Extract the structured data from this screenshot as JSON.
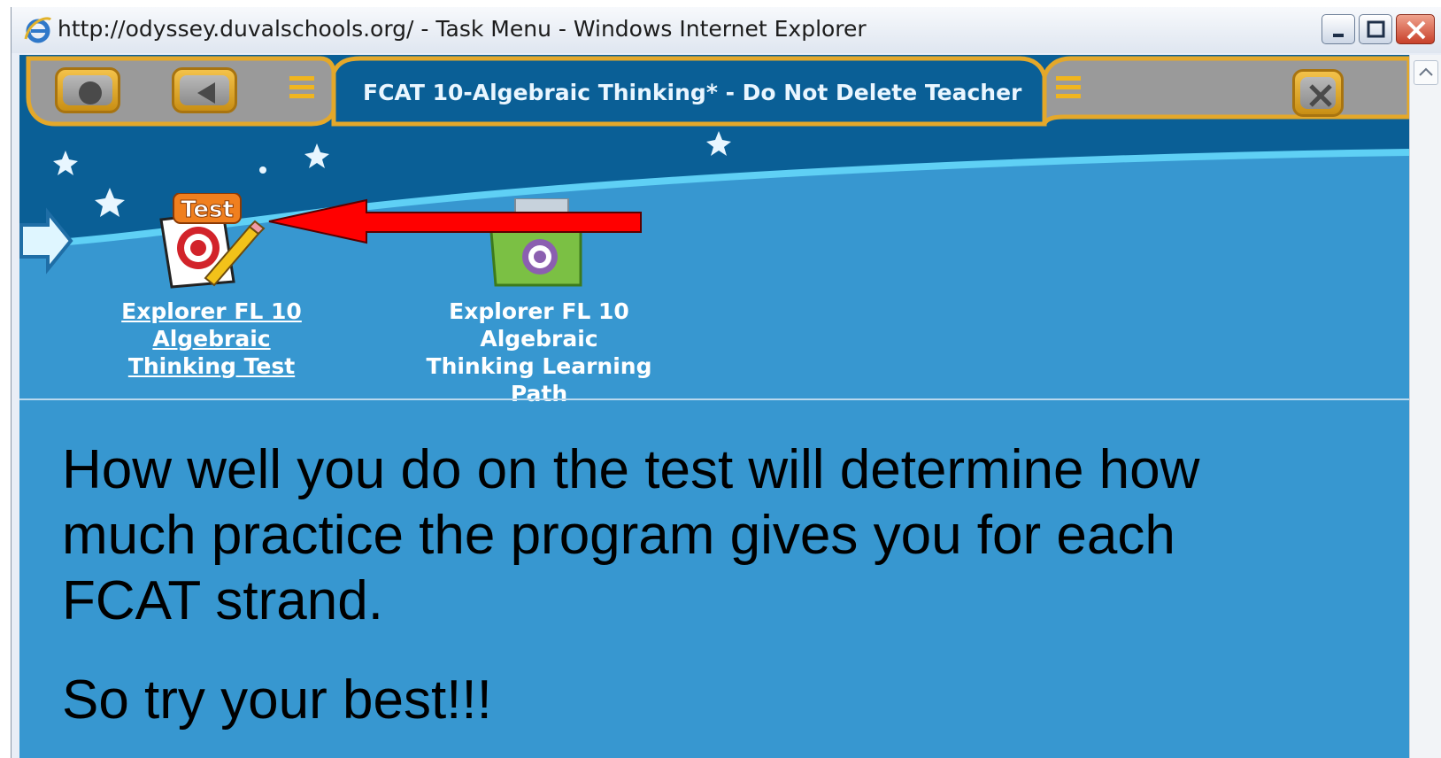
{
  "window": {
    "title": "http://odyssey.duvalschools.org/ - Task Menu - Windows Internet Explorer"
  },
  "app": {
    "tab_title": "FCAT 10-Algebraic Thinking* - Do Not Delete Teacher",
    "tiles": [
      {
        "icon": "test-icon",
        "badge": "Test",
        "line1": "Explorer FL 10 Algebraic",
        "line2": "Thinking Test",
        "linked": true
      },
      {
        "icon": "learning-path-folder-icon",
        "line1": "Explorer FL 10 Algebraic",
        "line2": "Thinking Learning Path",
        "linked": false
      }
    ]
  },
  "message": {
    "line1": "How well you do on the test will determine how",
    "line2": "much practice the program gives you for each",
    "line3": "FCAT strand.",
    "line4": "So try your best!!!"
  },
  "colors": {
    "app_background": "#3797d0",
    "header_dark": "#0a5f96",
    "tab_gold": "#e4a82a",
    "annotation_arrow": "#ff0000"
  }
}
